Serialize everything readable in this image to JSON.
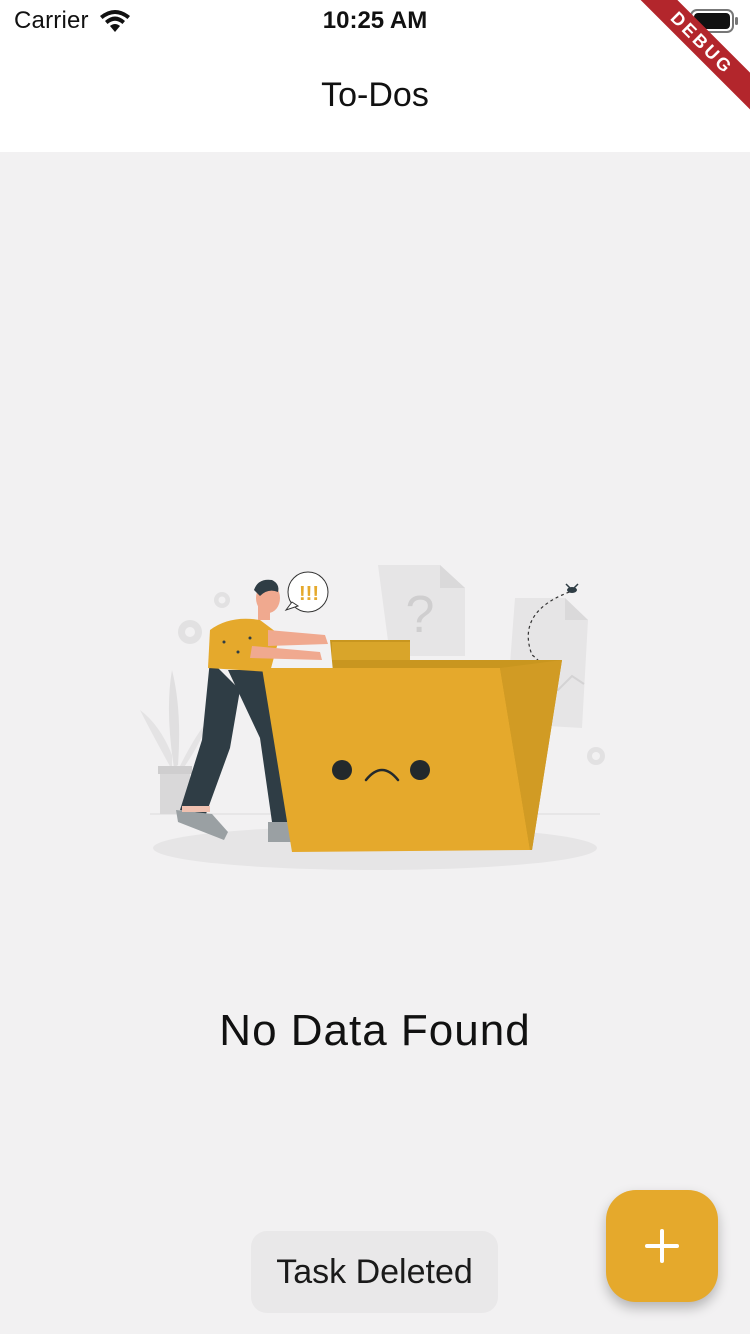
{
  "status_bar": {
    "carrier": "Carrier",
    "time": "10:25 AM",
    "wifi_icon": "wifi-icon",
    "battery_icon": "battery-icon"
  },
  "debug_banner": "DEBUG",
  "nav": {
    "title": "To-Dos"
  },
  "empty_state": {
    "illustration": "empty-folder-illustration",
    "alert_text": "!!!",
    "question_mark": "?",
    "message": "No Data Found"
  },
  "snackbar": {
    "message": "Task Deleted"
  },
  "fab": {
    "icon": "plus-icon"
  },
  "colors": {
    "accent": "#e5a92c",
    "background": "#f2f1f2",
    "surface": "#ffffff",
    "snackbar": "#e9e8e9",
    "debug": "#b3262c"
  }
}
